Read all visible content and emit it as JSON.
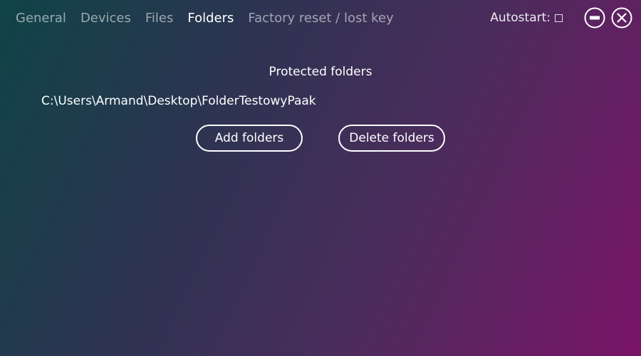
{
  "nav": {
    "tabs": [
      {
        "label": "General",
        "active": false
      },
      {
        "label": "Devices",
        "active": false
      },
      {
        "label": "Files",
        "active": false
      },
      {
        "label": "Folders",
        "active": true
      },
      {
        "label": "Factory reset / lost key",
        "active": false
      }
    ]
  },
  "controls": {
    "autostart_label": "Autostart:",
    "autostart_checked": false,
    "minimize_icon": "minimize-circle-icon",
    "close_icon": "close-circle-icon"
  },
  "folders": {
    "title": "Protected folders",
    "items": [
      "C:\\Users\\Armand\\Desktop\\FolderTestowyPaak"
    ],
    "add_label": "Add folders",
    "delete_label": "Delete folders"
  },
  "colors": {
    "gradient_start": "#0f4447",
    "gradient_end": "#7a1467",
    "text": "#ffffff"
  }
}
